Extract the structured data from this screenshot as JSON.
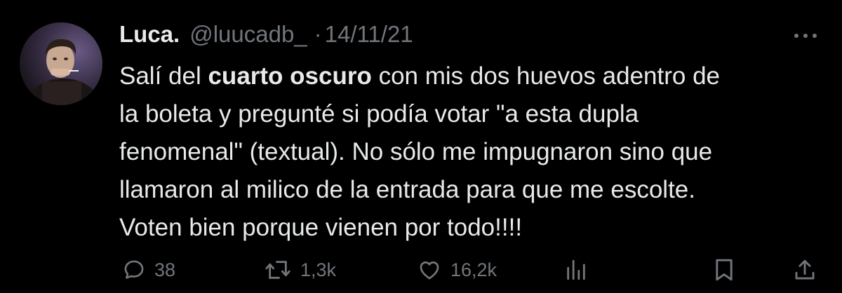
{
  "tweet": {
    "display_name": "Luca.",
    "handle": "@luucadb_",
    "separator": "·",
    "date": "14/11/21",
    "body": {
      "line1_pre": "Salí del ",
      "line1_bold": "cuarto oscuro",
      "line1_post": " con mis dos huevos adentro de",
      "line2": "la boleta y pregunté si podía votar \"a esta dupla",
      "line3": "fenomenal\" (textual). No sólo me impugnaron sino que",
      "line4": "llamaron al milico de la entrada para que me escolte.",
      "line5": "Voten bien porque vienen por todo!!!!"
    }
  },
  "actions": {
    "reply_count": "38",
    "retweet_count": "1,3k",
    "like_count": "16,2k"
  },
  "icons": {
    "reply": "reply-icon",
    "retweet": "retweet-icon",
    "like": "heart-icon",
    "views": "views-icon",
    "bookmark": "bookmark-icon",
    "share": "share-icon",
    "more": "more-icon"
  },
  "colors": {
    "background": "#000000",
    "text": "#e7e9ea",
    "secondary": "#71767b"
  }
}
